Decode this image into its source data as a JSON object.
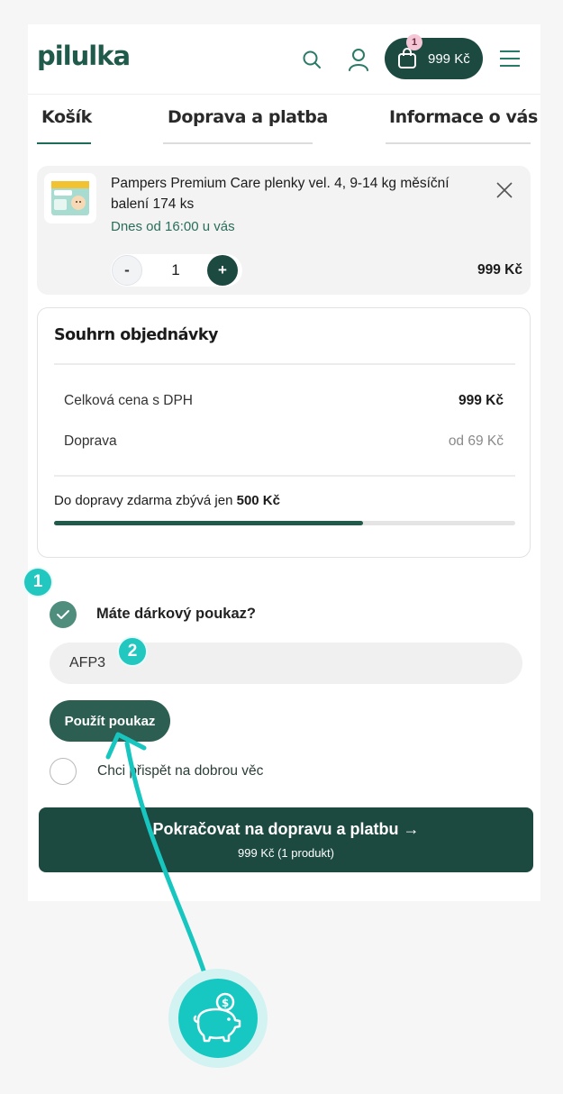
{
  "header": {
    "logo": "pilulka",
    "cart_count": "1",
    "cart_total": "999 Kč"
  },
  "tabs": [
    {
      "label": "Košík",
      "active": true
    },
    {
      "label": "Doprava a platba",
      "active": false
    },
    {
      "label": "Informace o vás",
      "active": false
    }
  ],
  "cart_item": {
    "name": "Pampers Premium Care plenky vel. 4, 9-14 kg měsíční balení 174 ks",
    "delivery": "Dnes od 16:00 u vás",
    "quantity": "1",
    "minus_label": "-",
    "plus_label": "+",
    "price": "999 Kč"
  },
  "summary": {
    "title": "Souhrn objednávky",
    "total_label": "Celková cena s DPH",
    "total_value": "999 Kč",
    "shipping_label": "Doprava",
    "shipping_value": "od 69 Kč",
    "free_shipping_prefix": "Do dopravy zdarma zbývá jen ",
    "free_shipping_amount": "500 Kč",
    "progress_fraction": 0.67
  },
  "voucher": {
    "checked": true,
    "label": "Máte dárkový poukaz?",
    "code": "AFP3",
    "apply_label": "Použít poukaz"
  },
  "donate": {
    "checked": false,
    "label": "Chci přispět na dobrou věc"
  },
  "continue": {
    "label": "Pokračovat na dopravu a platbu →",
    "sub": "999 Kč (1 produkt)"
  },
  "annotations": {
    "marker_1": "1",
    "marker_2": "2"
  },
  "colors": {
    "brand_dark": "#1d4a40",
    "brand_green": "#1f5a4a",
    "accent_teal": "#22c7c0"
  }
}
